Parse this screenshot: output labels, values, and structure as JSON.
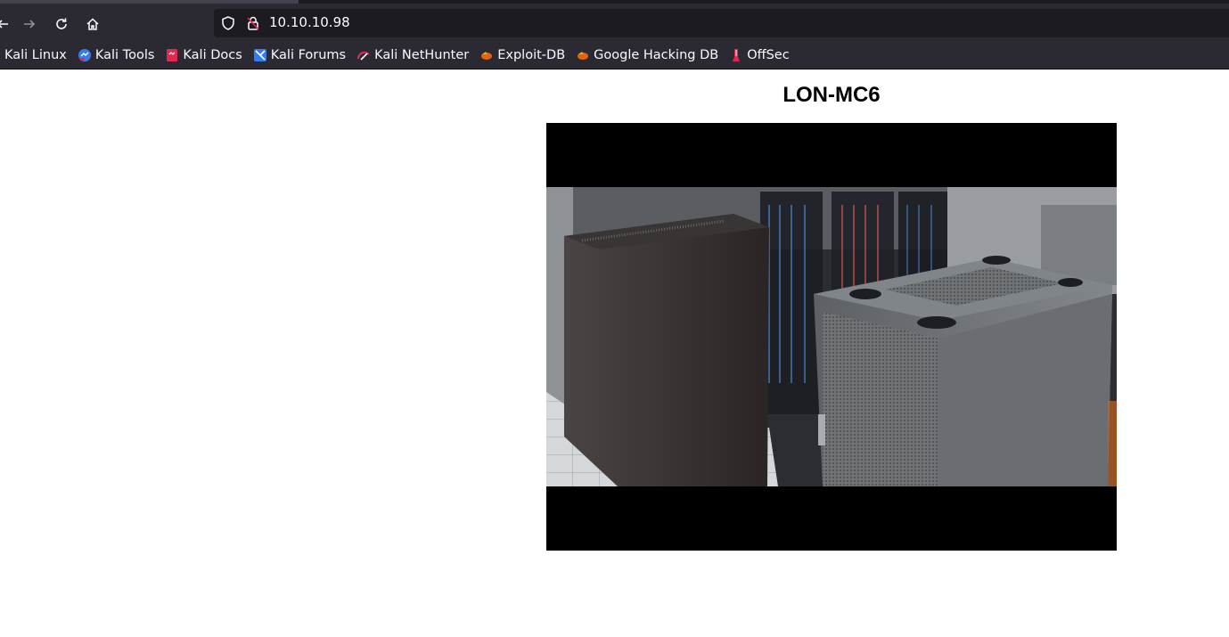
{
  "browser": {
    "url": "10.10.10.98",
    "bookmarks": [
      {
        "label": "Kali Linux",
        "icon": "kali-dragon-icon"
      },
      {
        "label": "Kali Tools",
        "icon": "kali-tools-icon"
      },
      {
        "label": "Kali Docs",
        "icon": "kali-docs-icon"
      },
      {
        "label": "Kali Forums",
        "icon": "kali-forums-icon"
      },
      {
        "label": "Kali NetHunter",
        "icon": "kali-nethunter-icon"
      },
      {
        "label": "Exploit-DB",
        "icon": "exploit-db-icon"
      },
      {
        "label": "Google Hacking DB",
        "icon": "ghdb-icon"
      },
      {
        "label": "OffSec",
        "icon": "offsec-icon"
      }
    ],
    "colors": {
      "chrome": "#2b2a33",
      "urlbar": "#1c1b22",
      "text": "#fbfbfe"
    }
  },
  "page": {
    "title": "LON-MC6",
    "stream": {
      "kind": "camera-feed",
      "scene": "server-racks"
    }
  }
}
